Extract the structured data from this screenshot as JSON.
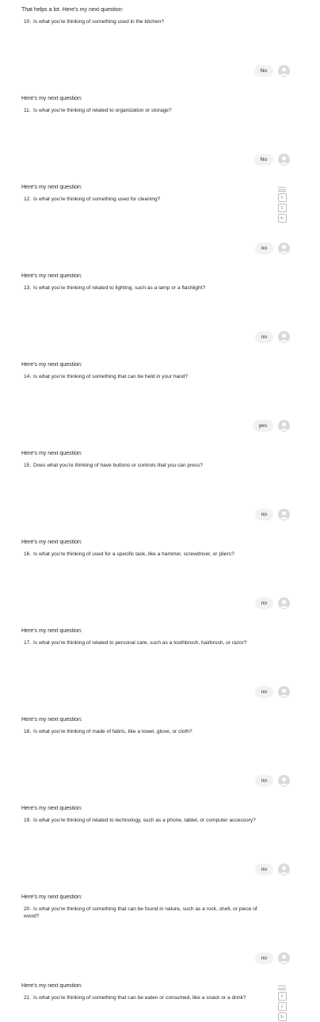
{
  "first": {
    "intro": "That helps a lot. Here's my next question:",
    "number": "10.",
    "question": "Is what you're thinking of something used in the kitchen?",
    "answer": "No"
  },
  "turns": [
    {
      "intro": "Here's my next question:",
      "number": "11.",
      "question": "Is what you're thinking of related to organization or storage?",
      "answer": "No"
    },
    {
      "intro": "Here's my next question:",
      "number": "12.",
      "question": "Is what you're thinking of something used for cleaning?",
      "answer": "no"
    },
    {
      "intro": "Here's my next question:",
      "number": "13.",
      "question": "Is what you're thinking of related to lighting, such as a lamp or a flashlight?",
      "answer": "no"
    },
    {
      "intro": "Here's my next question:",
      "number": "14.",
      "question": "Is what you're thinking of something that can be held in your hand?",
      "answer": "yes"
    },
    {
      "intro": "Here's my next question:",
      "number": "15.",
      "question": "Does what you're thinking of have buttons or controls that you can press?",
      "answer": "no"
    },
    {
      "intro": "Here's my next question:",
      "number": "16.",
      "question": "Is what you're thinking of used for a specific task, like a hammer, screwdriver, or pliers?",
      "answer": "no"
    },
    {
      "intro": "Here's my next question:",
      "number": "17.",
      "question": "Is what you're thinking of related to personal care, such as a toothbrush, hairbrush, or razor?",
      "answer": "no"
    },
    {
      "intro": "Here's my next question:",
      "number": "18.",
      "question": "Is what you're thinking of made of fabric, like a towel, glove, or cloth?",
      "answer": "no"
    },
    {
      "intro": "Here's my next question:",
      "number": "19.",
      "question": "Is what you're thinking of related to technology, such as a phone, tablet, or computer accessory?",
      "answer": "no"
    },
    {
      "intro": "Here's my next question:",
      "number": "20.",
      "question": "Is what you're thinking of something that can be found in nature, such as a rock, shell, or piece of wood?",
      "answer": "no"
    },
    {
      "intro": "Here's my next question:",
      "number": "21.",
      "question": "Is what you're thinking of something that can be eaten or consumed, like a snack or a drink?"
    }
  ],
  "icons": {
    "avatar": "user-avatar-icon",
    "copy": "copy-icon",
    "thumbs_up": "thumbs-up-icon",
    "thumbs_down": "thumbs-down-icon",
    "regenerate": "regenerate-icon"
  },
  "colors": {
    "bubble": "#f2f2f4",
    "avatar": "#d9dadd",
    "text": "#1f1f1f"
  }
}
